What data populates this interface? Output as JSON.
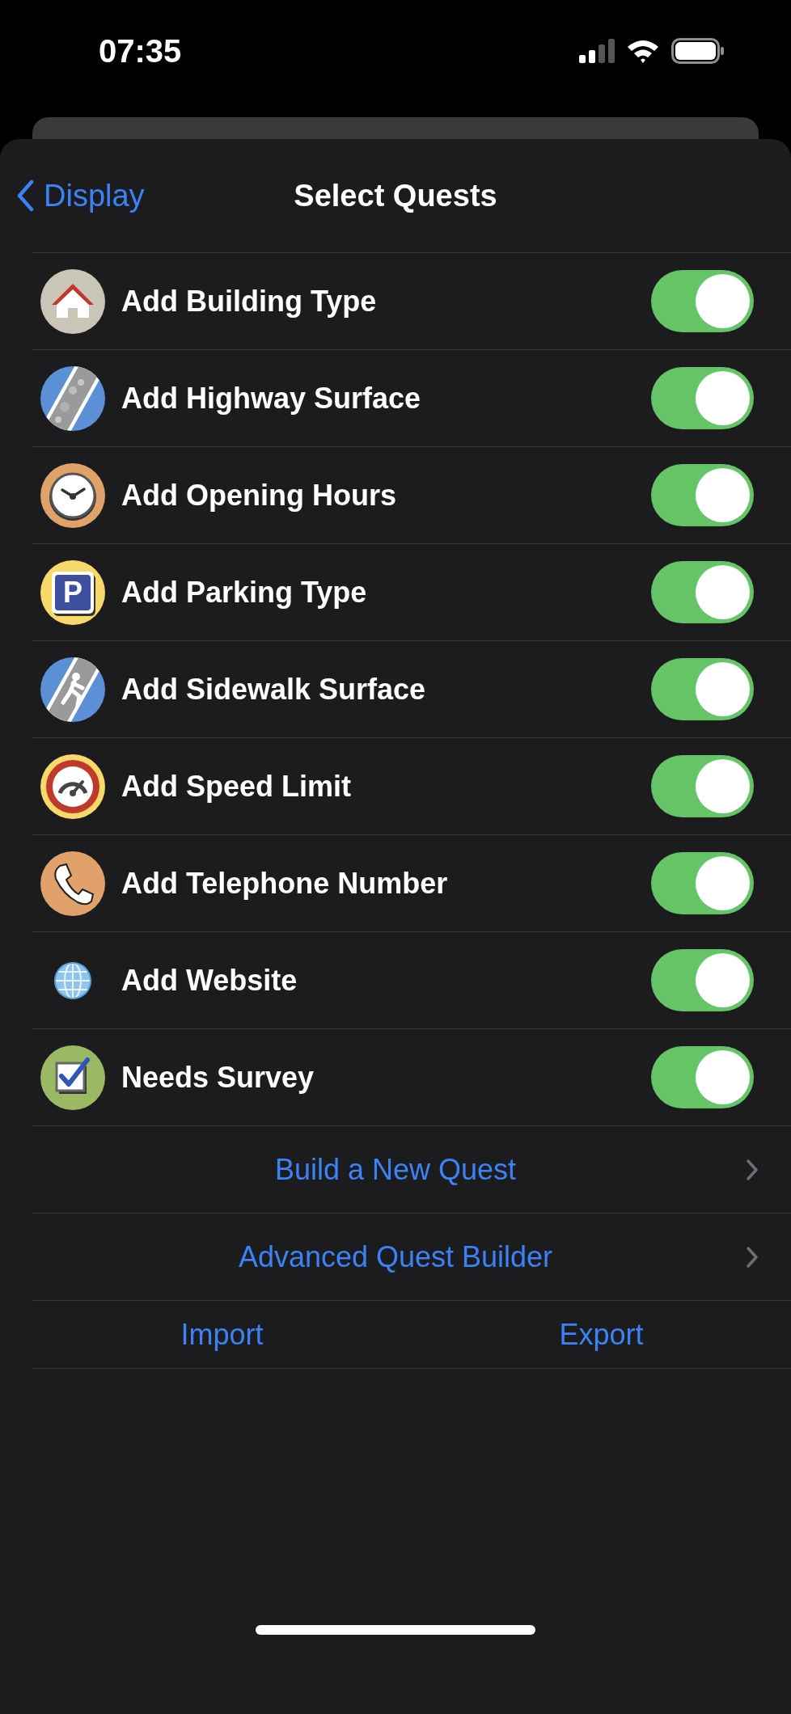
{
  "status_bar": {
    "time": "07:35"
  },
  "nav": {
    "back": "Display",
    "title": "Select Quests"
  },
  "quests": [
    {
      "kind": "building",
      "label": "Add Building Type",
      "on": true
    },
    {
      "kind": "highway",
      "label": "Add Highway Surface",
      "on": true
    },
    {
      "kind": "clock",
      "label": "Add Opening Hours",
      "on": true
    },
    {
      "kind": "parking",
      "label": "Add Parking Type",
      "on": true,
      "sign": "P"
    },
    {
      "kind": "sidewalk",
      "label": "Add Sidewalk Surface",
      "on": true
    },
    {
      "kind": "speed",
      "label": "Add Speed Limit",
      "on": true
    },
    {
      "kind": "phone",
      "label": "Add Telephone Number",
      "on": true
    },
    {
      "kind": "globe",
      "label": "Add Website",
      "on": true
    },
    {
      "kind": "survey",
      "label": "Needs Survey",
      "on": true
    }
  ],
  "links": [
    "Build a New Quest",
    "Advanced Quest Builder"
  ],
  "actions": [
    "Import",
    "Export"
  ]
}
